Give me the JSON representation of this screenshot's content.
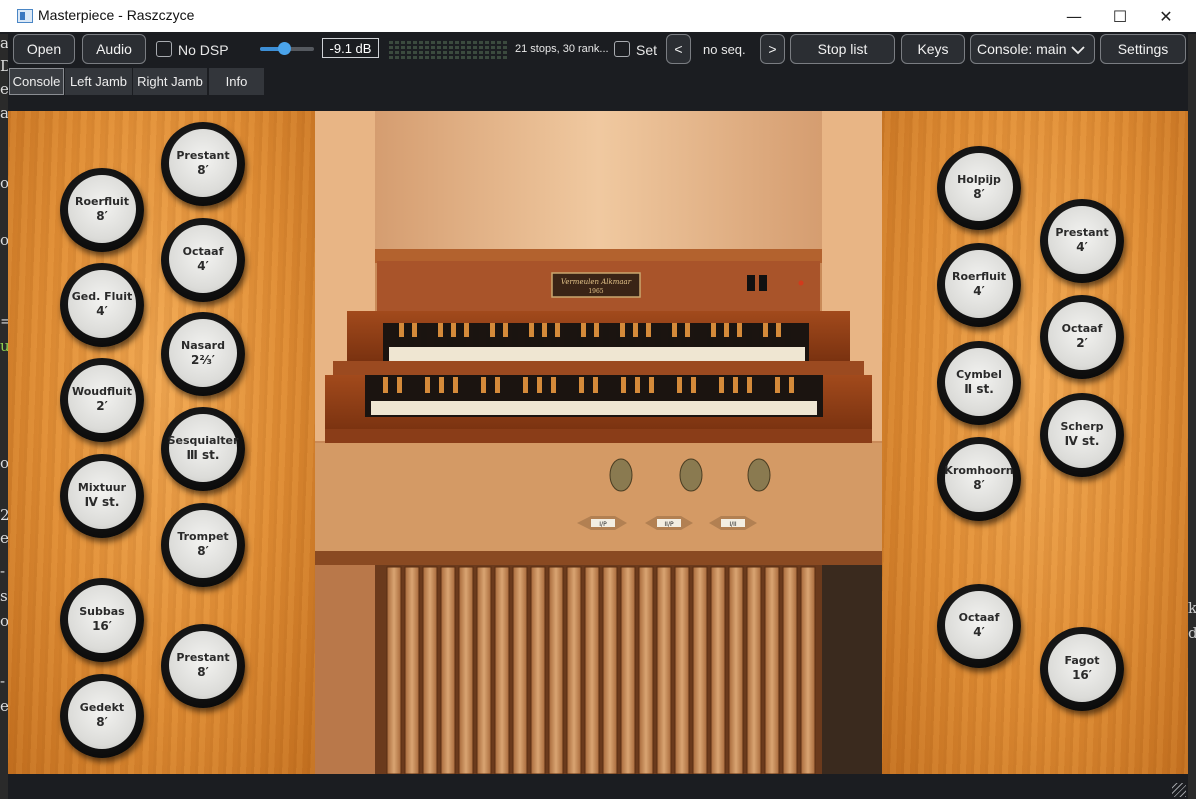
{
  "window": {
    "title": "Masterpiece - Raszczyce",
    "minimize_glyph": "—",
    "maximize_glyph": "☐",
    "close_glyph": "✕"
  },
  "toolbar": {
    "open_label": "Open",
    "audio_label": "Audio",
    "no_dsp_label": "No DSP",
    "no_dsp_checked": false,
    "volume_fraction": 0.45,
    "volume_readout": "-9.1 dB",
    "stops_info": "21 stops, 30 rank...",
    "set_label": "Set",
    "set_checked": false,
    "prev_label": "<",
    "seq_label": "no seq.",
    "next_label": ">",
    "stop_list_label": "Stop list",
    "keys_label": "Keys",
    "console_select": "Console: main",
    "settings_label": "Settings"
  },
  "tabs": [
    {
      "label": "Console",
      "active": true
    },
    {
      "label": "Left Jamb",
      "active": false
    },
    {
      "label": "Right Jamb",
      "active": false
    },
    {
      "label": "Info",
      "active": false
    }
  ],
  "left_jamb_stops": [
    {
      "name": "Roerfluit",
      "pitch": "8′"
    },
    {
      "name": "Prestant",
      "pitch": "8′"
    },
    {
      "name": "Ged. Fluit",
      "pitch": "4′"
    },
    {
      "name": "Octaaf",
      "pitch": "4′"
    },
    {
      "name": "Woudfluit",
      "pitch": "2′"
    },
    {
      "name": "Nasard",
      "pitch": "2⅔′"
    },
    {
      "name": "Mixtuur",
      "pitch": "Ⅳ st."
    },
    {
      "name": "Sesquialter",
      "pitch": "Ⅲ st."
    },
    {
      "name": "Trompet",
      "pitch": "8′"
    },
    {
      "name": "Subbas",
      "pitch": "16′"
    },
    {
      "name": "Prestant",
      "pitch": "8′"
    },
    {
      "name": "Gedekt",
      "pitch": "8′"
    }
  ],
  "right_jamb_stops": [
    {
      "name": "Holpijp",
      "pitch": "8′"
    },
    {
      "name": "Prestant",
      "pitch": "4′"
    },
    {
      "name": "Roerfluit",
      "pitch": "4′"
    },
    {
      "name": "Octaaf",
      "pitch": "2′"
    },
    {
      "name": "Cymbel",
      "pitch": "Ⅱ st."
    },
    {
      "name": "Scherp",
      "pitch": "Ⅳ st."
    },
    {
      "name": "Kromhoorn",
      "pitch": "8′"
    },
    {
      "name": "Octaaf",
      "pitch": "4′"
    },
    {
      "name": "Fagot",
      "pitch": "16′"
    }
  ],
  "nameplate": {
    "line1": "Vermeulen Alkmaar",
    "line2": "1965"
  },
  "couplers": [
    "I/P",
    "II/P",
    "I/II"
  ],
  "background_edge_text": {
    "left": [
      "a",
      "D",
      "e",
      "a",
      "o",
      "o",
      "=",
      "u",
      "o",
      "2",
      "e",
      "-",
      "s",
      "o",
      "-",
      "e"
    ],
    "right": [
      "k",
      "d"
    ]
  },
  "colors": {
    "wood": "#e08d34",
    "toolbar_bg": "#1b1d21",
    "accent": "#3d8fd6"
  }
}
